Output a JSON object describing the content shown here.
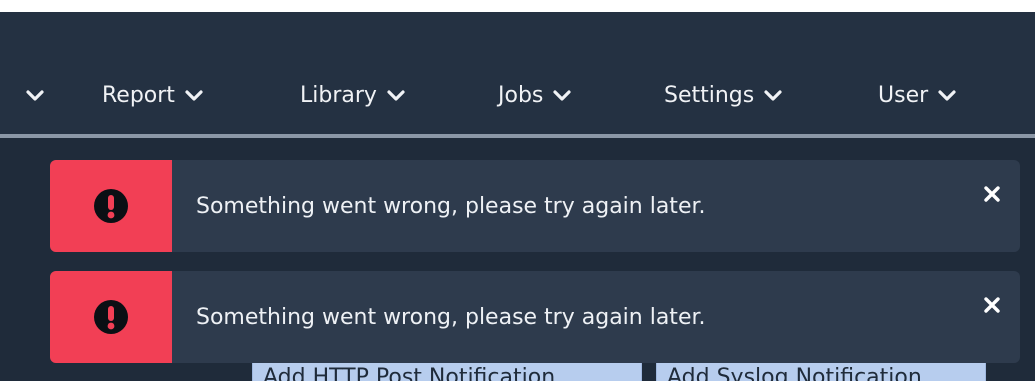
{
  "navbar": {
    "items": [
      {
        "label": "Report"
      },
      {
        "label": "Library"
      },
      {
        "label": "Jobs"
      },
      {
        "label": "Settings"
      },
      {
        "label": "User"
      }
    ]
  },
  "toasts": [
    {
      "message": "Something went wrong, please try again later.",
      "icon": "exclamation-circle-icon",
      "close_icon": "close-icon"
    },
    {
      "message": "Something went wrong, please try again later.",
      "icon": "exclamation-circle-icon",
      "close_icon": "close-icon"
    }
  ],
  "actions": {
    "add_http_post": "Add HTTP Post Notification",
    "add_syslog": "Add Syslog Notification"
  },
  "colors": {
    "navbar_bg": "#243142",
    "toast_bg": "#2e3b4d",
    "toast_accent": "#f23f55",
    "text": "#eef1f5",
    "button_bg": "#b7cdee"
  }
}
